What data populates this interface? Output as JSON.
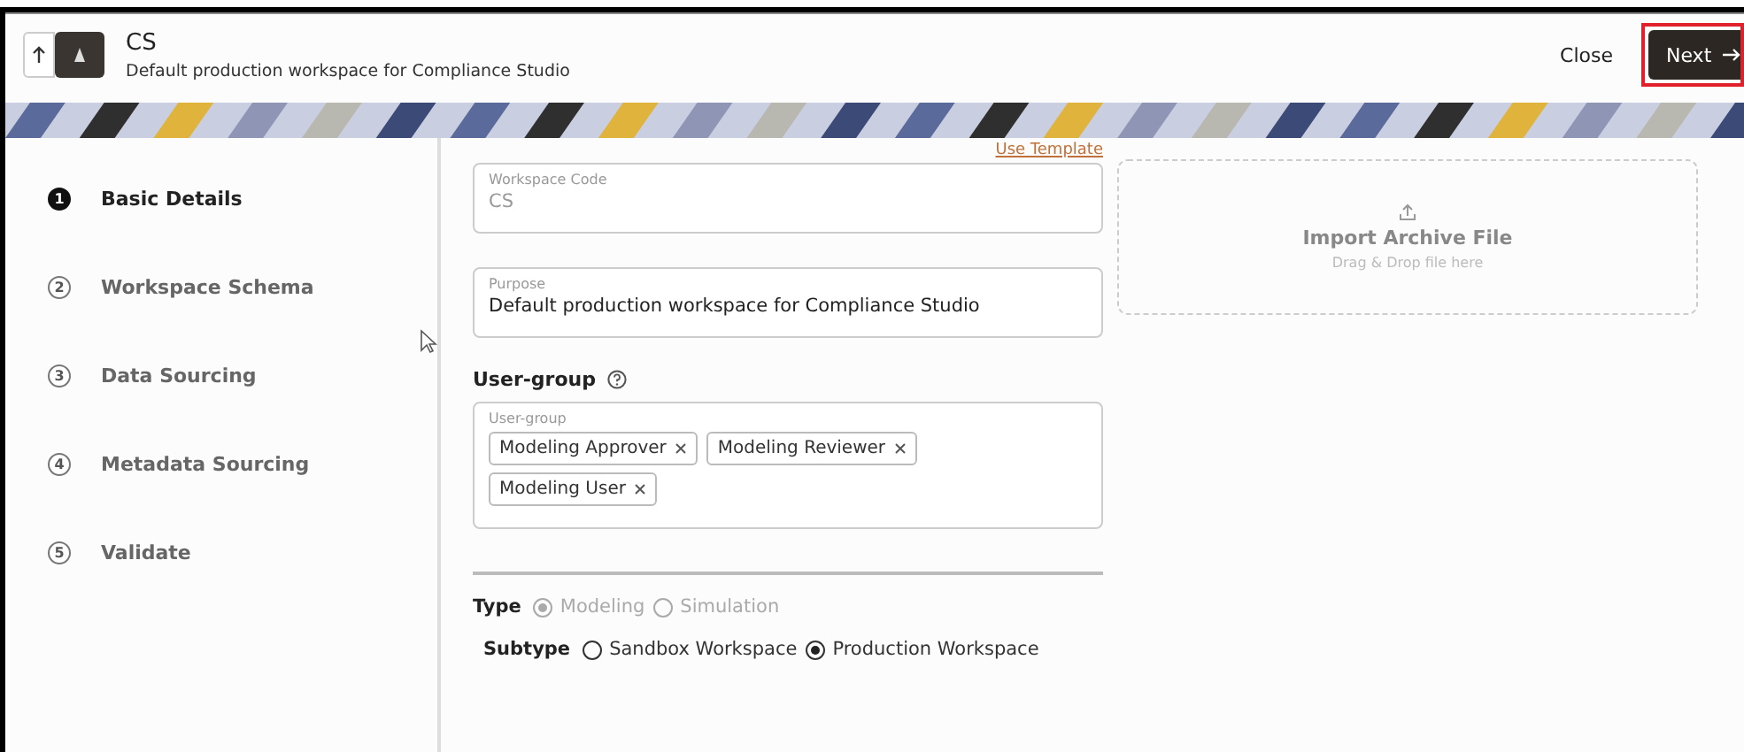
{
  "header": {
    "title": "CS",
    "subtitle": "Default production workspace for Compliance Studio",
    "close": "Close",
    "next": "Next",
    "next_highlighted": true
  },
  "steps": [
    {
      "number": "1",
      "label": "Basic Details",
      "selected": true
    },
    {
      "number": "2",
      "label": "Workspace Schema",
      "selected": false
    },
    {
      "number": "3",
      "label": "Data Sourcing",
      "selected": false
    },
    {
      "number": "4",
      "label": "Metadata Sourcing",
      "selected": false
    },
    {
      "number": "5",
      "label": "Validate",
      "selected": false
    }
  ],
  "form": {
    "use_template": "Use Template",
    "workspace_code": {
      "label": "Workspace Code",
      "value": "CS",
      "disabled": true
    },
    "purpose": {
      "label": "Purpose",
      "value": "Default production workspace for Compliance Studio",
      "disabled": false
    },
    "user_group": {
      "heading": "User-group",
      "label": "User-group",
      "chips": [
        "Modeling Approver",
        "Modeling Reviewer",
        "Modeling User"
      ]
    },
    "type": {
      "label": "Type",
      "disabled": true,
      "options": [
        {
          "label": "Modeling",
          "selected": true
        },
        {
          "label": "Simulation",
          "selected": false
        }
      ]
    },
    "subtype": {
      "label": "Subtype",
      "disabled": false,
      "options": [
        {
          "label": "Sandbox Workspace",
          "selected": false
        },
        {
          "label": "Production Workspace",
          "selected": true
        }
      ]
    }
  },
  "import": {
    "title": "Import Archive File",
    "hint": "Drag & Drop file here"
  }
}
